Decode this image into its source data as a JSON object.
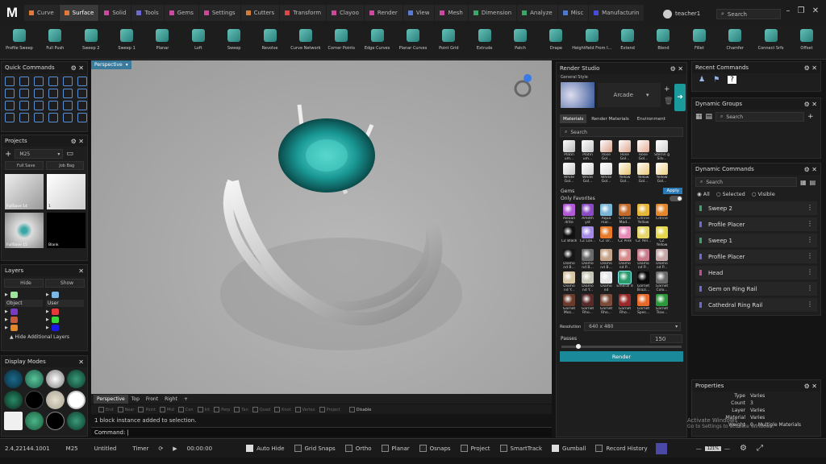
{
  "app": {
    "logo": "M"
  },
  "menu_tabs": [
    {
      "label": "Curve",
      "color": "#e07a3a",
      "active": false
    },
    {
      "label": "Surface",
      "color": "#e07a3a",
      "active": true
    },
    {
      "label": "Solid",
      "color": "#c94a9a",
      "active": false
    },
    {
      "label": "Tools",
      "color": "#6a6ad6",
      "active": false
    },
    {
      "label": "Gems",
      "color": "#c94a9a",
      "active": false
    },
    {
      "label": "Settings",
      "color": "#c94a9a",
      "active": false
    },
    {
      "label": "Cutters",
      "color": "#d67a3a",
      "active": false
    },
    {
      "label": "Transform",
      "color": "#d64a4a",
      "active": false
    },
    {
      "label": "Clayoo",
      "color": "#c94a9a",
      "active": false
    },
    {
      "label": "Render",
      "color": "#c94a9a",
      "active": false
    },
    {
      "label": "View",
      "color": "#5a7ad6",
      "active": false
    },
    {
      "label": "Mesh",
      "color": "#c94a9a",
      "active": false
    },
    {
      "label": "Dimension",
      "color": "#3aa66a",
      "active": false
    },
    {
      "label": "Analyze",
      "color": "#3aa66a",
      "active": false
    },
    {
      "label": "Misc",
      "color": "#4a7ad6",
      "active": false
    },
    {
      "label": "Manufacturin",
      "color": "#4a4ad6",
      "active": false
    }
  ],
  "user": {
    "name": "teacher1"
  },
  "top_search": {
    "placeholder": "Search"
  },
  "ribbon": [
    "Profile Sweep",
    "Full Push",
    "Sweep 2",
    "Sweep 1",
    "Planar",
    "Loft",
    "Sweep",
    "Revolve",
    "Curve Network",
    "Corner Points",
    "Edge Curves",
    "Planar Curves",
    "Point Grid",
    "Extrude",
    "Patch",
    "Drape",
    "Heightfield From I...",
    "Extend",
    "Blend",
    "Fillet",
    "Chamfer",
    "Connect Srfs",
    "Offset"
  ],
  "quick_commands": {
    "title": "Quick Commands"
  },
  "projects": {
    "title": "Projects",
    "selected": "M25",
    "full_save": "Full Save",
    "job_bag": "Job Bag",
    "items": [
      {
        "label": "FullSave 14"
      },
      {
        "label": "1"
      },
      {
        "label": "FullSave 15"
      },
      {
        "label": "Blank"
      }
    ]
  },
  "layers": {
    "title": "Layers",
    "hide": "Hide",
    "show": "Show",
    "object": "Object",
    "user": "User",
    "hide_additional": "Hide Additional Layers"
  },
  "display_modes": {
    "title": "Display Modes"
  },
  "viewport": {
    "label": "Perspective",
    "tabs": [
      "Perspective",
      "Top",
      "Front",
      "Right",
      "+"
    ],
    "snaps": [
      "End",
      "Near",
      "Point",
      "Mid",
      "Cen",
      "Int",
      "Perp",
      "Tan",
      "Quad",
      "Knot",
      "Vertex",
      "Project",
      "Disable"
    ],
    "output_prefix": "1 block instance",
    "output": "added to selection.",
    "command_label": "Command:"
  },
  "render_studio": {
    "title": "Render Studio",
    "general_style": "General Style",
    "style": "Arcade",
    "tabs": [
      "Materials",
      "Render Materials",
      "Environment"
    ],
    "search": "Search",
    "metals": [
      "Platin um...",
      "Platin um...",
      "Rose Gol...",
      "Rose Gol...",
      "Rose Gol...",
      "Sterlin g Silv...",
      "White Gol...",
      "White Gol...",
      "White Gol...",
      "Yellow Gol...",
      "Yellow Gol...",
      "Yellow Gol..."
    ],
    "metal_colors": [
      "#b8b8b8",
      "#c4c4c4",
      "#d9a08a",
      "#dea48e",
      "#e3aa94",
      "#d0d0d0",
      "#c8c8c8",
      "#d2d2d2",
      "#dcdcdc",
      "#e6c36a",
      "#ebc976",
      "#f0d080"
    ],
    "gems_label": "Gems",
    "apply": "Apply",
    "only_favorites": "Only Favorites",
    "gems": [
      {
        "label": "Alexan drite",
        "color": "#b25ad6"
      },
      {
        "label": "Ameth yst",
        "color": "#8a4ac6"
      },
      {
        "label": "Aqua mar...",
        "color": "#7ab6d6"
      },
      {
        "label": "Citrine Mad...",
        "color": "#c66a2a"
      },
      {
        "label": "Citrine Yellow",
        "color": "#e6b63a"
      },
      {
        "label": "Citrine",
        "color": "#e6862a"
      },
      {
        "label": "CZ Black",
        "color": "#111111"
      },
      {
        "label": "CZ Lav...",
        "color": "#a48ae6"
      },
      {
        "label": "CZ Or...",
        "color": "#e67a2a"
      },
      {
        "label": "CZ Pink",
        "color": "#e68ab6"
      },
      {
        "label": "CZ Yell...",
        "color": "#e6d66a"
      },
      {
        "label": "CZ Yellow",
        "color": "#e6d64a"
      },
      {
        "label": "Diamo nd B...",
        "color": "#161616"
      },
      {
        "label": "Diamo nd B...",
        "color": "#6a6a6a"
      },
      {
        "label": "Diamo nd B...",
        "color": "#c6a48a"
      },
      {
        "label": "Diamo nd P...",
        "color": "#d68a8a"
      },
      {
        "label": "Diamo nd P...",
        "color": "#c67a8a"
      },
      {
        "label": "Diamo nd P...",
        "color": "#c6a6a6"
      },
      {
        "label": "Diamo nd Y...",
        "color": "#d6c6a6"
      },
      {
        "label": "Diamo nd Y...",
        "color": "#c6c6b6"
      },
      {
        "label": "Diamo nd",
        "color": "#e6e6e6"
      },
      {
        "label": "Emeral d",
        "color": "#2a9a6a"
      },
      {
        "label": "Garnet Brazi...",
        "color": "#0a0a0a"
      },
      {
        "label": "Garnet Colo...",
        "color": "#6a6a6a"
      },
      {
        "label": "Garnet Moz...",
        "color": "#6a3a2a"
      },
      {
        "label": "Garnet Rho...",
        "color": "#5a2a2a"
      },
      {
        "label": "Garnet Rho...",
        "color": "#7a4a3a"
      },
      {
        "label": "Garnet Rho...",
        "color": "#9a2a2a"
      },
      {
        "label": "Garnet Spes...",
        "color": "#e66a2a"
      },
      {
        "label": "Garnet Tsav...",
        "color": "#2a9a3a"
      }
    ],
    "resolution_label": "Resolution",
    "resolution": "640 x 480",
    "passes_label": "Passes",
    "passes": "150",
    "render": "Render"
  },
  "recent_commands": {
    "title": "Recent Commands"
  },
  "dynamic_groups": {
    "title": "Dynamic Groups",
    "search": "Search"
  },
  "dynamic_commands": {
    "title": "Dynamic Commands",
    "search": "Search",
    "filters": [
      "All",
      "Selected",
      "Visible"
    ],
    "items": [
      {
        "label": "Sweep 2",
        "color": "#3aa66a"
      },
      {
        "label": "Profile Placer",
        "color": "#6a6ad6"
      },
      {
        "label": "Sweep 1",
        "color": "#3aa66a"
      },
      {
        "label": "Profile Placer",
        "color": "#6a6ad6"
      },
      {
        "label": "Head",
        "color": "#c94a9a"
      },
      {
        "label": "Gem on Ring Rail",
        "color": "#6a6ad6"
      },
      {
        "label": "Cathedral Ring Rail",
        "color": "#6a6ad6"
      }
    ]
  },
  "properties": {
    "title": "Properties",
    "rows": [
      {
        "k": "Type",
        "v": "Varies"
      },
      {
        "k": "Count",
        "v": "3"
      },
      {
        "k": "Layer",
        "v": "Varies"
      },
      {
        "k": "Material",
        "v": "Varies"
      },
      {
        "k": "Weight",
        "v": "0 - Multiple Materials"
      }
    ]
  },
  "watermark": {
    "line1": "Activate Windows",
    "line2": "Go to Settings to activate Windows."
  },
  "status": {
    "coords": "2.4,22144.1001",
    "layer": "M25",
    "file": "Untitled",
    "timer_label": "Timer",
    "time": "00:00:00",
    "toggles": [
      {
        "label": "Auto Hide",
        "on": true
      },
      {
        "label": "Grid Snaps",
        "on": false
      },
      {
        "label": "Ortho",
        "on": false
      },
      {
        "label": "Planar",
        "on": false
      },
      {
        "label": "Osnaps",
        "on": false
      },
      {
        "label": "Project",
        "on": false
      },
      {
        "label": "SmartTrack",
        "on": false
      },
      {
        "label": "Gumball",
        "on": true
      },
      {
        "label": "Record History",
        "on": false
      }
    ],
    "zoom": "121%"
  }
}
